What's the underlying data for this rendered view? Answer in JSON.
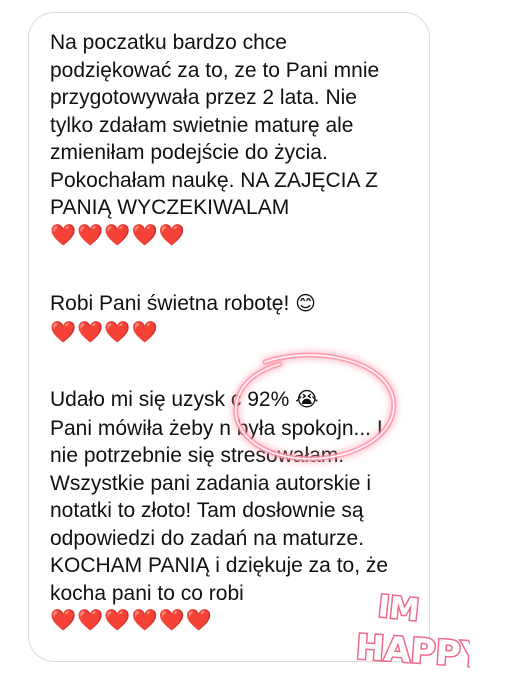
{
  "message": {
    "paragraph1": [
      "Na poczatku bardzo chce",
      "podziękować za to, ze to Pani mnie",
      "przygotowywała przez 2 lata. Nie",
      "tylko zdałam swietnie maturę ale",
      "zmieniłam podejście do życia.",
      "Pokochałam naukę. NA ZAJĘCIA Z",
      "PANIĄ WYCZEKIWALAM"
    ],
    "hearts1": "❤️❤️❤️❤️❤️",
    "paragraph2": "Robi Pani świetna robotę!",
    "emoji2": "😊",
    "hearts2": "❤️❤️❤️❤️",
    "paragraph3": [
      "Udało mi się uzysk    c 92%",
      "Pani mówiła żeby   n była spokojn... I",
      "nie potrzebnie się stresowałam.",
      "Wszystkie pani zadania autorskie i",
      "notatki to złoto! Tam dosłownie są",
      "odpowiedzi do zadań na maturze.",
      "KOCHAM PANIĄ i dziękuje za to, że",
      "kocha pani to co robi"
    ],
    "emoji3": "😭",
    "hearts3": "❤️❤️❤️❤️❤️❤️"
  },
  "sticker": {
    "line1": "IM",
    "line2": "HAPPY",
    "color": "#f06a8a"
  },
  "colors": {
    "heart": "#e0142c",
    "glow": "#ff4d6d",
    "bubble_border": "#dcdcdc"
  }
}
